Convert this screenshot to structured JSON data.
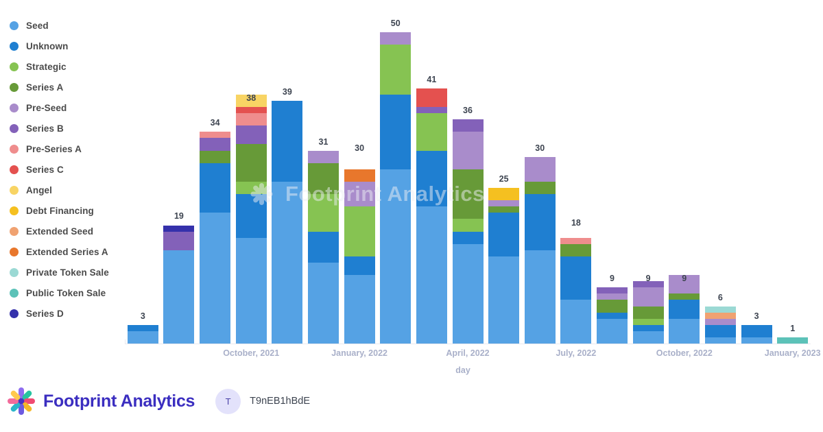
{
  "footer": {
    "brand_name": "Footprint Analytics",
    "user_initial": "T",
    "user_name": "T9nEB1hBdE",
    "brand_color": "#3b2ec0"
  },
  "watermark": {
    "text": "Footprint Analytics"
  },
  "chart_data": {
    "type": "bar",
    "stacked": true,
    "title": "",
    "xlabel": "day",
    "ylabel": "",
    "grid": false,
    "legend_position": "left",
    "ylim": [
      0,
      50
    ],
    "categories": [
      "2021-07",
      "2021-08",
      "2021-09",
      "2021-10",
      "2021-11",
      "2021-12",
      "2022-01",
      "2022-02",
      "2022-03",
      "2022-04",
      "2022-05",
      "2022-06",
      "2022-07",
      "2022-08",
      "2022-09",
      "2022-10",
      "2022-11",
      "2022-12",
      "2023-01"
    ],
    "axis_ticks": [
      {
        "label": "October, 2021",
        "index": 3
      },
      {
        "label": "January, 2022",
        "index": 6
      },
      {
        "label": "April, 2022",
        "index": 9
      },
      {
        "label": "July, 2022",
        "index": 12
      },
      {
        "label": "October, 2022",
        "index": 15
      },
      {
        "label": "January, 2023",
        "index": 18
      }
    ],
    "totals": [
      3,
      19,
      34,
      38,
      39,
      31,
      30,
      50,
      41,
      36,
      25,
      30,
      18,
      9,
      9,
      9,
      6,
      3,
      1
    ],
    "series": [
      {
        "name": "Seed",
        "color": "#55a2e4",
        "values": [
          2,
          15,
          21,
          17,
          26,
          13,
          11,
          28,
          22,
          16,
          14,
          15,
          7,
          4,
          2,
          4,
          1,
          1,
          0
        ]
      },
      {
        "name": "Unknown",
        "color": "#1f7fd1",
        "values": [
          1,
          0,
          8,
          7,
          13,
          5,
          3,
          12,
          9,
          2,
          7,
          9,
          7,
          1,
          1,
          3,
          2,
          2,
          0
        ]
      },
      {
        "name": "Strategic",
        "color": "#86c352",
        "values": [
          0,
          0,
          0,
          2,
          0,
          6,
          8,
          8,
          6,
          2,
          0,
          0,
          0,
          0,
          1,
          0,
          0,
          0,
          0
        ]
      },
      {
        "name": "Series A",
        "color": "#679a38",
        "values": [
          0,
          0,
          2,
          6,
          0,
          5,
          0,
          0,
          0,
          8,
          1,
          2,
          2,
          2,
          2,
          1,
          0,
          0,
          0
        ]
      },
      {
        "name": "Pre-Seed",
        "color": "#a98ccb",
        "values": [
          0,
          0,
          0,
          0,
          0,
          2,
          4,
          2,
          0,
          6,
          1,
          4,
          0,
          1,
          3,
          3,
          1,
          0,
          0
        ]
      },
      {
        "name": "Series B",
        "color": "#8361b9",
        "values": [
          0,
          3,
          2,
          3,
          0,
          0,
          0,
          0,
          1,
          2,
          0,
          0,
          0,
          1,
          1,
          0,
          0,
          0,
          0
        ]
      },
      {
        "name": "Pre-Series A",
        "color": "#ef8d8d",
        "values": [
          0,
          0,
          1,
          2,
          0,
          0,
          0,
          0,
          0,
          0,
          0,
          0,
          1,
          0,
          0,
          0,
          0,
          0,
          0
        ]
      },
      {
        "name": "Series C",
        "color": "#e4514f",
        "values": [
          0,
          0,
          0,
          1,
          0,
          0,
          0,
          0,
          3,
          0,
          0,
          0,
          0,
          0,
          0,
          0,
          0,
          0,
          0
        ]
      },
      {
        "name": "Angel",
        "color": "#f8d464",
        "values": [
          0,
          0,
          0,
          2,
          0,
          0,
          0,
          0,
          0,
          0,
          0,
          0,
          0,
          0,
          0,
          0,
          0,
          0,
          0
        ]
      },
      {
        "name": "Debt Financing",
        "color": "#f5c020",
        "values": [
          0,
          0,
          0,
          0,
          0,
          0,
          0,
          0,
          0,
          0,
          2,
          0,
          0,
          0,
          0,
          0,
          0,
          0,
          0
        ]
      },
      {
        "name": "Extended Seed",
        "color": "#f0a271",
        "values": [
          0,
          0,
          0,
          0,
          0,
          0,
          0,
          0,
          0,
          0,
          0,
          0,
          0,
          0,
          0,
          0,
          1,
          0,
          0
        ]
      },
      {
        "name": "Extended Series A",
        "color": "#e8772c",
        "values": [
          0,
          0,
          0,
          0,
          0,
          0,
          2,
          0,
          0,
          0,
          0,
          0,
          0,
          0,
          0,
          0,
          0,
          0,
          0
        ]
      },
      {
        "name": "Private Token Sale",
        "color": "#9bd9d4",
        "values": [
          0,
          0,
          0,
          0,
          0,
          0,
          0,
          0,
          0,
          0,
          0,
          0,
          0,
          0,
          0,
          0,
          1,
          0,
          0
        ]
      },
      {
        "name": "Public Token Sale",
        "color": "#5cc2b8",
        "values": [
          0,
          0,
          0,
          0,
          0,
          0,
          0,
          0,
          0,
          0,
          0,
          0,
          0,
          0,
          0,
          0,
          0,
          0,
          1
        ]
      },
      {
        "name": "Series D",
        "color": "#3531ab",
        "values": [
          0,
          1,
          0,
          0,
          0,
          0,
          0,
          0,
          0,
          0,
          0,
          0,
          0,
          0,
          0,
          0,
          0,
          0,
          0
        ]
      }
    ]
  }
}
